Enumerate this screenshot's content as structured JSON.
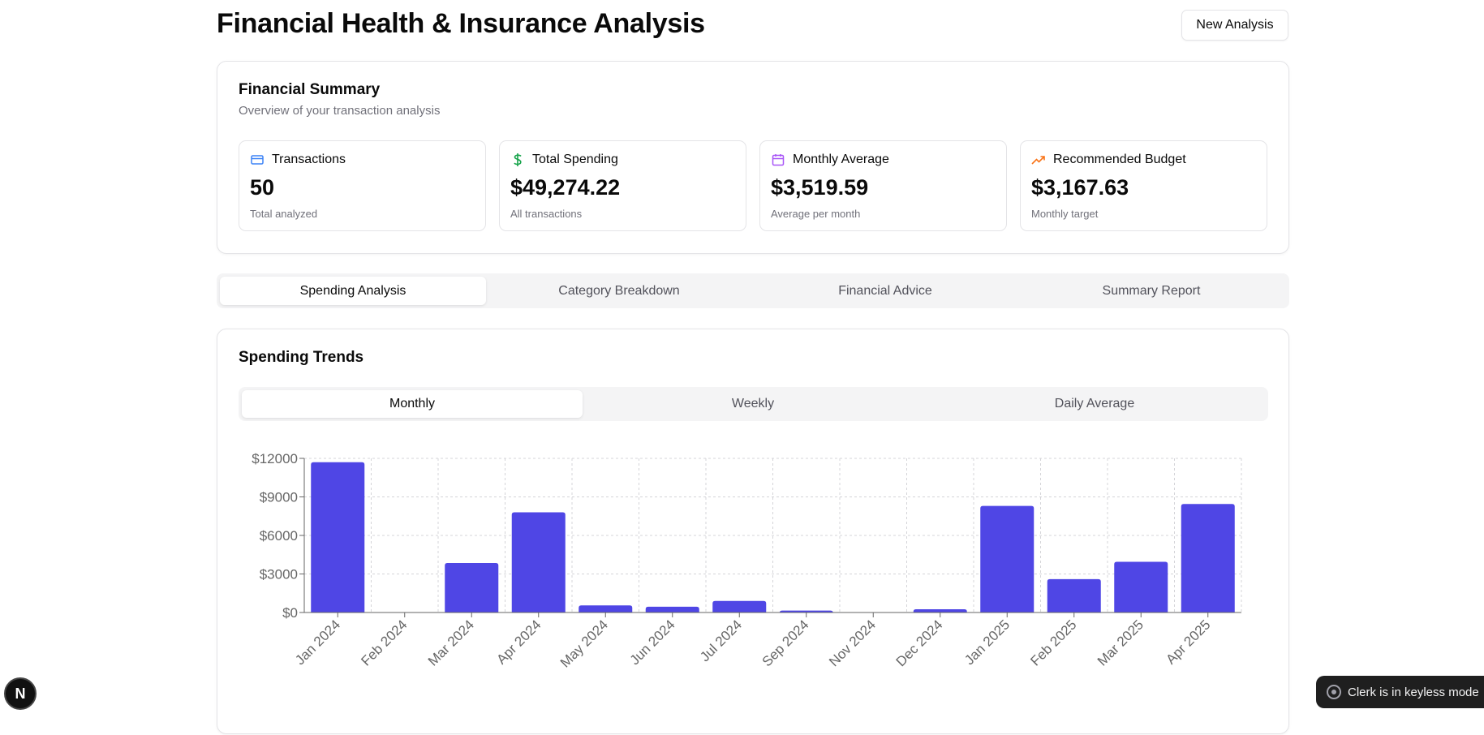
{
  "header": {
    "title": "Financial Health & Insurance Analysis",
    "new_analysis_label": "New Analysis"
  },
  "summary": {
    "title": "Financial Summary",
    "description": "Overview of your transaction analysis",
    "stats": [
      {
        "label": "Transactions",
        "value": "50",
        "sub": "Total analyzed",
        "icon": "credit-card-icon",
        "color": "#3b82f6"
      },
      {
        "label": "Total Spending",
        "value": "$49,274.22",
        "sub": "All transactions",
        "icon": "dollar-sign-icon",
        "color": "#16a34a"
      },
      {
        "label": "Monthly Average",
        "value": "$3,519.59",
        "sub": "Average per month",
        "icon": "calendar-icon",
        "color": "#a855f7"
      },
      {
        "label": "Recommended Budget",
        "value": "$3,167.63",
        "sub": "Monthly target",
        "icon": "trending-up-icon",
        "color": "#f97316"
      }
    ]
  },
  "tabs": [
    "Spending Analysis",
    "Category Breakdown",
    "Financial Advice",
    "Summary Report"
  ],
  "active_tab": "Spending Analysis",
  "trends": {
    "title": "Spending Trends",
    "subtabs": [
      "Monthly",
      "Weekly",
      "Daily Average"
    ],
    "active_subtab": "Monthly"
  },
  "chart_data": {
    "type": "bar",
    "categories": [
      "Jan 2024",
      "Feb 2024",
      "Mar 2024",
      "Apr 2024",
      "May 2024",
      "Jun 2024",
      "Jul 2024",
      "Sep 2024",
      "Nov 2024",
      "Dec 2024",
      "Jan 2025",
      "Feb 2025",
      "Mar 2025",
      "Apr 2025"
    ],
    "values": [
      11700,
      0,
      3850,
      7800,
      550,
      450,
      900,
      150,
      0,
      250,
      8300,
      2600,
      3950,
      8450
    ],
    "ylim": [
      0,
      12000
    ],
    "yticks": [
      "$0",
      "$3000",
      "$6000",
      "$9000",
      "$12000"
    ],
    "grid": true,
    "bar_color": "#4f46e5"
  },
  "footer": {
    "next_badge": "N",
    "clerk_text": "Clerk is in keyless mode"
  }
}
